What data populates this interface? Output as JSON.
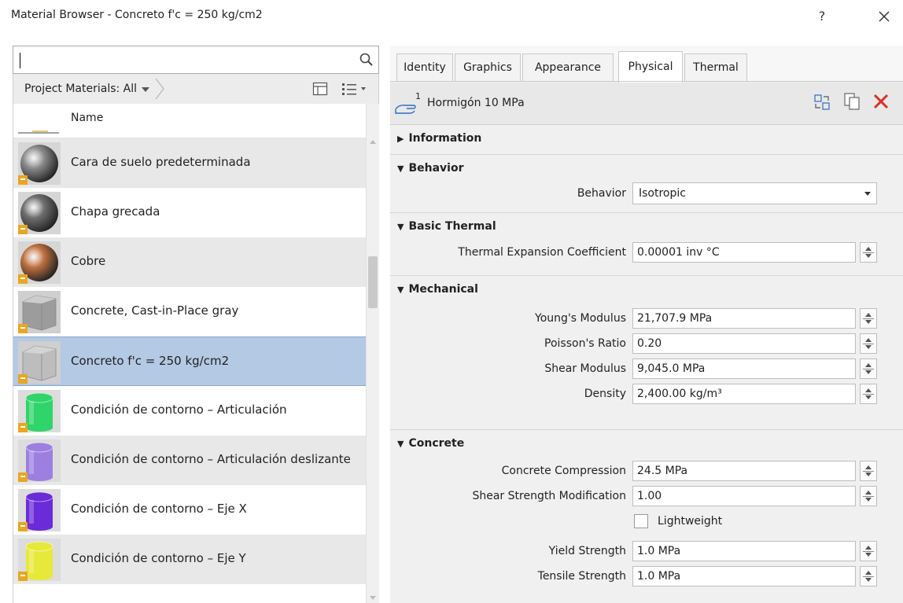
{
  "window": {
    "title": "Material Browser - Concreto f'c = 250 kg/cm2",
    "help_label": "?"
  },
  "browser": {
    "search_value": "",
    "filter_label": "Project Materials: All",
    "list_header": "Name",
    "selected_index": 4,
    "materials": [
      {
        "name": "Cara de suelo predeterminada",
        "icon": "sphere-gray-icon",
        "color": "#8a8a8a"
      },
      {
        "name": "Chapa grecada",
        "icon": "sphere-gray-icon",
        "color": "#6f6f6f"
      },
      {
        "name": "Cobre",
        "icon": "sphere-copper-icon",
        "color": "#c0703f"
      },
      {
        "name": "Concrete, Cast-in-Place gray",
        "icon": "cube-concrete-icon",
        "color": "#9c9c9c"
      },
      {
        "name": "Concreto f'c = 250 kg/cm2",
        "icon": "cube-concrete-icon",
        "color": "#bdbdbd"
      },
      {
        "name": "Condición de contorno – Articulación",
        "icon": "cylinder-green-icon",
        "color": "#2fd46a"
      },
      {
        "name": "Condición de contorno – Articulación deslizante",
        "icon": "cylinder-lavender-icon",
        "color": "#9d7fe0"
      },
      {
        "name": "Condición de contorno – Eje X",
        "icon": "cylinder-purple-icon",
        "color": "#6a2bd8"
      },
      {
        "name": "Condición de contorno – Eje Y",
        "icon": "cylinder-yellow-icon",
        "color": "#e6e93a"
      }
    ]
  },
  "tabs": {
    "items": [
      "Identity",
      "Graphics",
      "Appearance",
      "Physical",
      "Thermal"
    ],
    "active": "Physical"
  },
  "asset": {
    "number": "1",
    "name": "Hormigón 10 MPa"
  },
  "sections": {
    "information": "Information",
    "behavior": "Behavior",
    "basic_thermal": "Basic Thermal",
    "mechanical": "Mechanical",
    "concrete": "Concrete"
  },
  "properties": {
    "behavior": {
      "label": "Behavior",
      "value": "Isotropic"
    },
    "thermal_expansion": {
      "label": "Thermal Expansion Coefficient",
      "value": "0.00001 inv °C"
    },
    "youngs_modulus": {
      "label": "Young's Modulus",
      "value": "21,707.9 MPa"
    },
    "poissons_ratio": {
      "label": "Poisson's Ratio",
      "value": "0.20"
    },
    "shear_modulus": {
      "label": "Shear Modulus",
      "value": "9,045.0 MPa"
    },
    "density": {
      "label": "Density",
      "value": "2,400.00 kg/m³"
    },
    "concrete_compression": {
      "label": "Concrete Compression",
      "value": "24.5 MPa"
    },
    "shear_strength_mod": {
      "label": "Shear Strength Modification",
      "value": "1.00"
    },
    "lightweight": {
      "label": "Lightweight",
      "checked": false
    },
    "yield_strength": {
      "label": "Yield Strength",
      "value": "1.0 MPa"
    },
    "tensile_strength": {
      "label": "Tensile Strength",
      "value": "1.0 MPa"
    }
  },
  "colors": {
    "selection": "#b3c9e4",
    "remove_red": "#d9302a",
    "accent_blue": "#2a6fc4"
  }
}
